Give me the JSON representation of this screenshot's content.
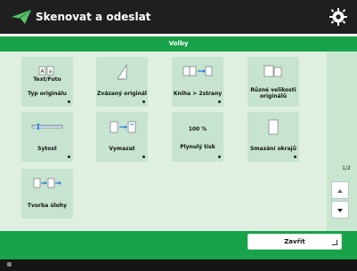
{
  "header": {
    "title": "Skenovat a odeslat",
    "logo_icon": "send-paper-plane-icon",
    "settings_icon": "gear-icon"
  },
  "tab": {
    "title": "Volby"
  },
  "tiles": [
    {
      "name": "original-type-tile",
      "value": "Text/Foto",
      "label": "Typ originálu"
    },
    {
      "name": "bound-original-tile",
      "label": "Zvázaný originál"
    },
    {
      "name": "book-two-sides-tile",
      "label": "Kniha > 2strany"
    },
    {
      "name": "different-sizes-tile",
      "label": "Různé velikosti originálů"
    },
    {
      "name": "sharpness-tile",
      "label": "Sytost"
    },
    {
      "name": "erase-frame-tile",
      "label": "Vymazat"
    },
    {
      "name": "print-density-tile",
      "value": "100 %",
      "label": "Plynulý tisk"
    },
    {
      "name": "sharpen-tile",
      "label": "Smazání okrajů"
    },
    {
      "name": "job-build-tile",
      "label": "Tvorba úlohy"
    }
  ],
  "pagination": {
    "text": "1/2"
  },
  "footer": {
    "close_label": "Zavřít"
  },
  "colors": {
    "header_bg": "#1f1f1f",
    "accent_green": "#18a34a",
    "panel_bg": "#dff0e3",
    "tile_bg": "#c6e4cf"
  }
}
